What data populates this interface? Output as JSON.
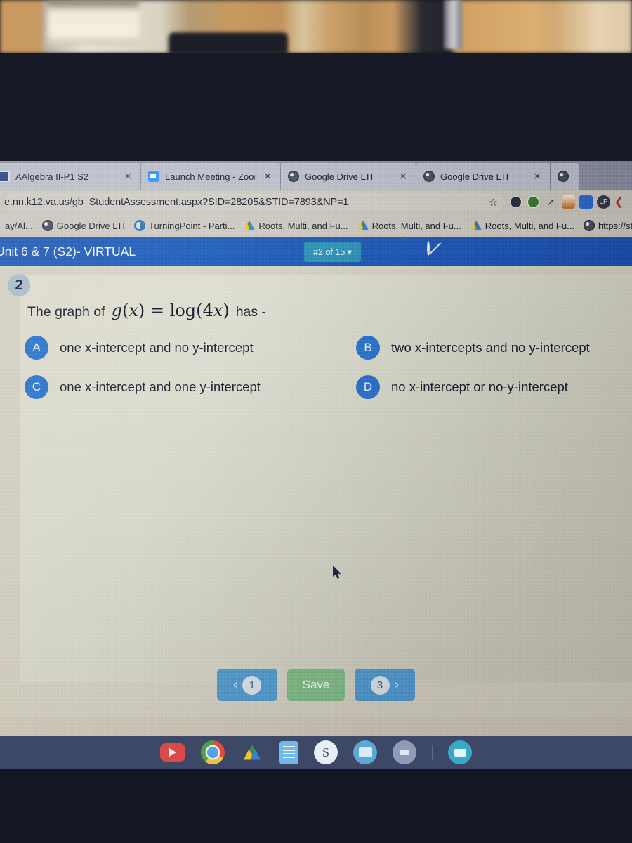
{
  "browser": {
    "tabs": [
      {
        "title": "AAlgebra II-P1 S2",
        "favicon": "school-icon",
        "close": "×"
      },
      {
        "title": "Launch Meeting - Zoom",
        "favicon": "zoom-icon",
        "close": "×"
      },
      {
        "title": "Google Drive LTI",
        "favicon": "globe-icon",
        "close": "×"
      },
      {
        "title": "Google Drive LTI",
        "favicon": "globe-icon",
        "close": "×"
      }
    ],
    "url": "e.nn.k12.va.us/gb_StudentAssessment.aspx?SID=28205&STID=7893&NP=1",
    "star": "☆",
    "extensions": [
      "shield-dark-icon",
      "shield-green-icon",
      "arrows-icon",
      "mouse-dropper-icon",
      "puzzle-icon",
      "lastpass-icon",
      "red-bird-icon"
    ],
    "bookmarks": [
      {
        "label": "ay/Al...",
        "favicon": "none"
      },
      {
        "label": "Google Drive LTI",
        "favicon": "globe-icon"
      },
      {
        "label": "TurningPoint - Parti...",
        "favicon": "turningpoint-icon"
      },
      {
        "label": "Roots, Multi, and Fu...",
        "favicon": "drive-icon"
      },
      {
        "label": "Roots, Multi, and Fu...",
        "favicon": "drive-icon"
      },
      {
        "label": "Roots, Multi, and Fu...",
        "favicon": "drive-icon"
      },
      {
        "label": "https://stu",
        "favicon": "globe-icon"
      }
    ]
  },
  "assessment": {
    "title": "Unit 6 & 7 (S2)- VIRTUAL",
    "question_counter": "#2 of 15 ▾",
    "tools": [
      "document-icon",
      "pencil-icon",
      "no-entry-icon"
    ]
  },
  "question": {
    "number": "2",
    "prompt_prefix": "The graph of",
    "formula_g": "g",
    "formula_paren_open": "(",
    "formula_x": "x",
    "formula_paren_close": ")",
    "formula_equals": "=",
    "formula_log": "log(",
    "formula_4": "4",
    "formula_x2": "x",
    "formula_close2": ")",
    "prompt_suffix": "has -",
    "options": [
      {
        "letter": "A",
        "text": "one x-intercept and no y-intercept"
      },
      {
        "letter": "B",
        "text": "two x-intercepts and no y-intercept"
      },
      {
        "letter": "C",
        "text": "one x-intercept and one y-intercept"
      },
      {
        "letter": "D",
        "text": "no x-intercept or no-y-intercept"
      }
    ]
  },
  "navigation": {
    "prev_chevron": "‹",
    "prev_number": "1",
    "save_label": "Save",
    "next_number": "3",
    "next_chevron": "›"
  },
  "shelf": {
    "icons": [
      "youtube-icon",
      "chrome-icon",
      "google-drive-icon",
      "google-docs-icon",
      "schoology-icon",
      "files-icon",
      "camera-icon",
      "zoom-icon"
    ],
    "schoology_letter": "S"
  },
  "colors": {
    "header_blue": "#1f58b5",
    "counter_teal": "#2e8fb3",
    "answer_blue": "#2b72c9",
    "save_green": "#88bd8e",
    "nav_blue": "#5aa0cf",
    "shelf": "#3c4866"
  }
}
